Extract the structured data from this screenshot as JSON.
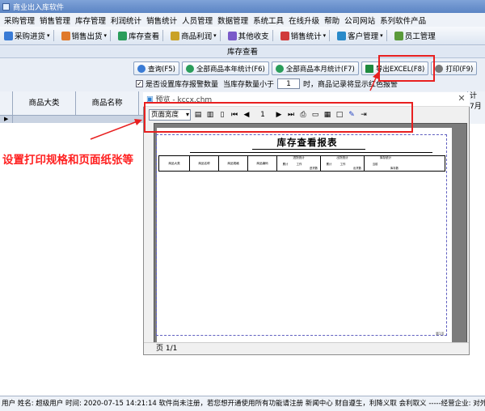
{
  "window": {
    "title": "商业出入库软件"
  },
  "menu": [
    "采购管理",
    "销售管理",
    "库存管理",
    "利润统计",
    "销售统计",
    "人员管理",
    "数据管理",
    "系统工具",
    "在线升级",
    "帮助",
    "公司网站",
    "系列软件产品"
  ],
  "toolbar": [
    {
      "label": "采购进货",
      "icon": "purchase-icon",
      "color": "#3a7bd5"
    },
    {
      "label": "销售出货",
      "icon": "sales-icon",
      "color": "#e07a2a"
    },
    {
      "label": "库存查看",
      "icon": "inventory-icon",
      "color": "#2a9d5a"
    },
    {
      "label": "商品利润",
      "icon": "profit-icon",
      "color": "#c9a227"
    },
    {
      "label": "其他收支",
      "icon": "income-expense-icon",
      "color": "#7a5ac9"
    },
    {
      "label": "销售统计",
      "icon": "stats-icon",
      "color": "#d03a3a"
    },
    {
      "label": "客户管理",
      "icon": "customer-icon",
      "color": "#2a8ac9"
    },
    {
      "label": "员工管理",
      "icon": "employee-icon",
      "color": "#5a9a3a"
    }
  ],
  "tab": {
    "label": "库存查看"
  },
  "actions": [
    {
      "label": "查询(F5)",
      "icon": "search-icon",
      "color": "#3a7bd5"
    },
    {
      "label": "全部商品本年统计(F6)",
      "icon": "check-icon",
      "color": "#2a9d5a"
    },
    {
      "label": "全部商品本月统计(F7)",
      "icon": "check-icon",
      "color": "#2a9d5a"
    },
    {
      "label": "导出EXCEL(F8)",
      "icon": "excel-icon",
      "color": "#1e8a3e"
    },
    {
      "label": "打印(F9)",
      "icon": "print-icon",
      "color": "#777777"
    }
  ],
  "options": {
    "checkbox_label": "是否设置库存报警数量",
    "qty_label": "当库存数量小于",
    "qty_value": "1",
    "qty_suffix": "时，商品记录将显示红色报警"
  },
  "grid": {
    "columns": [
      "商品大类",
      "商品名称"
    ],
    "right_header": "计",
    "right_cell": "7月"
  },
  "preview": {
    "title": "预览 - kccx.chm",
    "zoom": "页面宽度",
    "page_input": "1",
    "report_title": "库存查看报表",
    "columns": [
      "商品大类",
      "商品名称",
      "商品规格",
      "商品编码"
    ],
    "groups": [
      {
        "label": "进货统计",
        "subs": [
          "累计",
          "工作",
          "进货数"
        ]
      },
      {
        "label": "出货统计",
        "subs": [
          "累计",
          "工作",
          "出货数"
        ]
      },
      {
        "label": "库存统计",
        "subs": [
          "当前",
          "库存数"
        ]
      }
    ],
    "page_footer": "第1页",
    "status": "页 1/1"
  },
  "annotation": "设置打印规格和页面纸张等",
  "statusbar": "用户  姓名: 超级用户  时间: 2020-07-15 14:21:14  软件尚未注册，若您想开通使用所有功能请注册  新闻中心  财自遵生，利降义取  会利取义  -----经营企业: 对外诚信，对内",
  "colors": {
    "accent": "#5b84c4",
    "annotation": "#ff2020",
    "dash": "#6060c0"
  }
}
